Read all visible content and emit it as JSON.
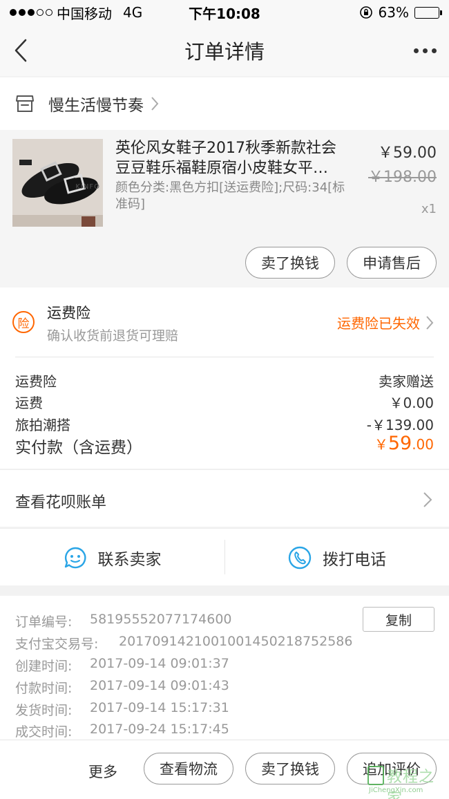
{
  "status_bar": {
    "carrier": "中国移动",
    "network": "4G",
    "time": "下午10:08",
    "battery": "63%",
    "battery_level": 0.63
  },
  "nav": {
    "title": "订单详情"
  },
  "shop": {
    "name": "慢生活慢节奏"
  },
  "item": {
    "title": "英伦风女鞋子2017秋季新款社会豆豆鞋乐福鞋原宿小皮鞋女平…",
    "sku": "颜色分类:黑色方扣[送运费险];尺码:34[标准码]",
    "price": "￥59.00",
    "original_price": "￥198.00",
    "quantity": "x1",
    "thumb_text": "KINFO",
    "buttons": {
      "exchange": "卖了换钱",
      "after_sale": "申请售后"
    }
  },
  "insurance": {
    "icon_text": "险",
    "title": "运费险",
    "subtitle": "确认收货前退货可理赔",
    "status": "运费险已失效"
  },
  "fees": [
    {
      "label": "运费险",
      "value": "卖家赠送"
    },
    {
      "label": "运费",
      "value": "￥0.00"
    },
    {
      "label": "旅拍潮搭",
      "value": "-￥139.00"
    }
  ],
  "total": {
    "label": "实付款（含运费）",
    "currency": "￥",
    "integer": "59",
    "decimal": ".00"
  },
  "huabei": {
    "label": "查看花呗账单"
  },
  "contact": {
    "seller": "联系卖家",
    "phone": "拨打电话"
  },
  "order_info": {
    "order_no_label": "订单编号:",
    "order_no": "58195552077174600",
    "copy": "复制",
    "alipay_label": "支付宝交易号:",
    "alipay_no": "2017091421001001450218752586",
    "created_label": "创建时间:",
    "created": "2017-09-14 09:01:37",
    "paid_label": "付款时间:",
    "paid": "2017-09-14 09:01:43",
    "shipped_label": "发货时间:",
    "shipped": "2017-09-14 15:17:31",
    "done_label": "成交时间:",
    "done": "2017-09-24 15:17:45"
  },
  "footer": {
    "more": "更多",
    "logistics": "查看物流",
    "exchange": "卖了换钱",
    "review": "追加评价"
  },
  "watermark": {
    "cn": "教程之家",
    "en": "JiChengXin.com"
  },
  "colors": {
    "accent": "#ff6600",
    "contact_blue": "#2aa5e6"
  }
}
